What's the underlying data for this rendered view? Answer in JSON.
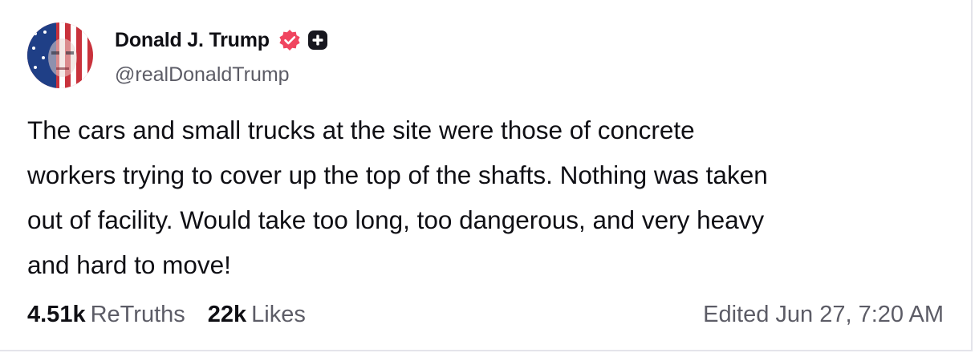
{
  "post": {
    "author": {
      "display_name": "Donald J. Trump",
      "handle": "@realDonaldTrump",
      "avatar_icon": "avatar-flag-portrait",
      "verified_icon": "verified-badge-icon",
      "plus_icon": "plus-badge-icon"
    },
    "text": "The cars and small trucks at the site were those of concrete\nworkers trying to cover up the top of the shafts. Nothing was taken\nout of facility. Would take too long, too dangerous, and very heavy\nand hard to move!",
    "stats": {
      "retruths_value": "4.51k",
      "retruths_label": "ReTruths",
      "likes_value": "22k",
      "likes_label": "Likes"
    },
    "edited": "Edited Jun 27, 7:20 AM"
  },
  "colors": {
    "text_primary": "#0f0f14",
    "text_secondary": "#5c5c66",
    "verified_badge": "#f0455f",
    "plus_badge": "#17171f"
  }
}
